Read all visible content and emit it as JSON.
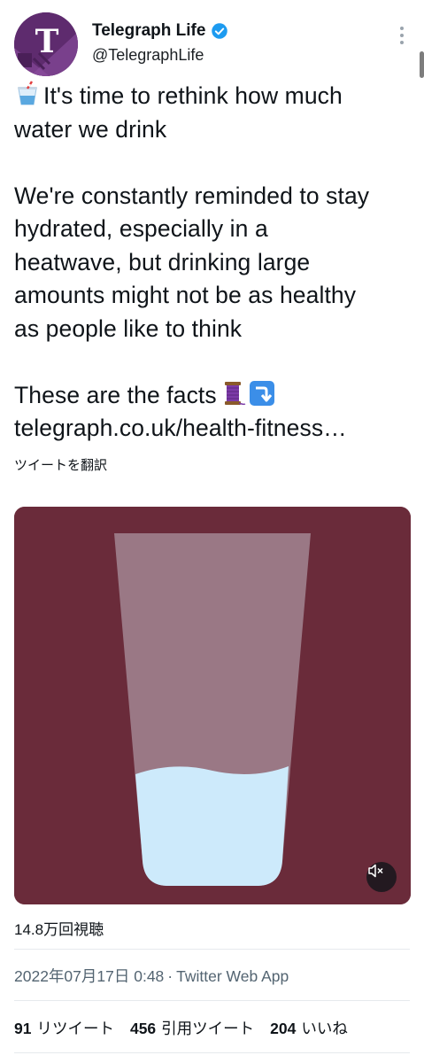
{
  "author": {
    "display_name": "Telegraph Life",
    "handle": "@TelegraphLife",
    "verified": true,
    "avatar_color": "#5e2b6e"
  },
  "tweet": {
    "line1": "It's time to rethink how much",
    "line2": "water we drink",
    "line3": "We're constantly reminded to stay",
    "line4": "hydrated, especially in a",
    "line5": "heatwave, but drinking large",
    "line6": "amounts might not be as healthy",
    "line7": "as people like to think",
    "line8": "These are the facts",
    "link": "telegraph.co.uk/health-fitness…",
    "emojis": [
      "cup-with-straw-icon",
      "thread-icon",
      "arrow-down-icon"
    ]
  },
  "translate_label": "ツイートを翻訳",
  "video": {
    "background": "#6a2b3a",
    "glass_color": "#9a7885",
    "water_color": "#cdeafb",
    "water_level": 0.36,
    "muted": true
  },
  "views_label": "14.8万回視聴",
  "meta": {
    "timestamp": "2022年07月17日 0:48",
    "separator": "·",
    "source": "Twitter Web App"
  },
  "stats": {
    "retweets_count": "91",
    "retweets_label": "リツイート",
    "quotes_count": "456",
    "quotes_label": "引用ツイート",
    "likes_count": "204",
    "likes_label": "いいね"
  }
}
